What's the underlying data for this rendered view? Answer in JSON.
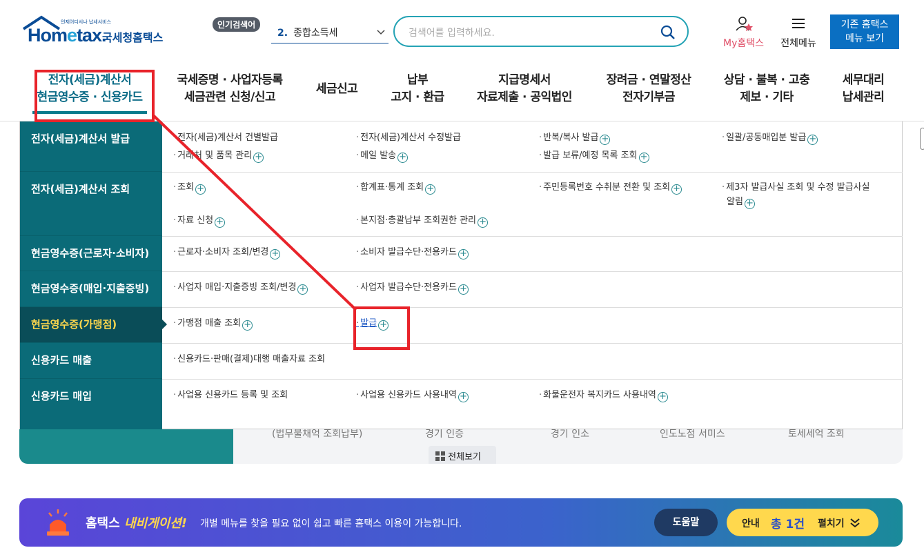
{
  "logo": {
    "sub": "언제어디서나 납세서비스",
    "word_a": "Hom",
    "word_e": "e",
    "word_b": "tax.",
    "kr": "국세청홈택스"
  },
  "popular": {
    "badge": "인기검색어",
    "rank": "2.",
    "term": "종합소득세"
  },
  "search": {
    "placeholder": "검색어를 입력하세요."
  },
  "top_links": {
    "myhome": "My홈택스",
    "allmenu": "전체메뉴",
    "legacy_line1": "기존 홈택스",
    "legacy_line2": "메뉴 보기"
  },
  "gnb": [
    {
      "l1": "전자(세금)계산서",
      "l2": "현금영수증 · 신용카드"
    },
    {
      "l1": "국세증명 · 사업자등록",
      "l2": "세금관련 신청/신고"
    },
    {
      "l1": "세금신고",
      "l2": ""
    },
    {
      "l1": "납부",
      "l2": "고지 · 환급"
    },
    {
      "l1": "지급명세서",
      "l2": "자료제출 · 공익법인"
    },
    {
      "l1": "장려금 · 연말정산",
      "l2": "전자기부금"
    },
    {
      "l1": "상담 · 불복 · 고충",
      "l2": "제보 · 기타"
    },
    {
      "l1": "세무대리",
      "l2": "납세관리"
    }
  ],
  "categories": [
    "전자(세금)계산서 발급",
    "전자(세금)계산서 조회",
    "현금영수증(근로자·소비자)",
    "현금영수증(매입·지출증빙)",
    "현금영수증(가맹점)",
    "신용카드 매출",
    "신용카드 매입"
  ],
  "links": {
    "r1": [
      "전자(세금)계산서 건별발급",
      "전자(세금)계산서 수정발급",
      "반복/복사 발급",
      "일괄/공동매입분 발급",
      "거래처 및 품목 관리",
      "메일 발송",
      "발급 보류/예정 목록 조회"
    ],
    "r2": [
      "조회",
      "합계표·통계 조회",
      "주민등록번호 수취분 전환 및 조회",
      "제3자 발급사실 조회 및 수정 발급사실",
      "알림",
      "자료 신청",
      "본지점·총괄납부 조회권한 관리"
    ],
    "r3": [
      "근로자·소비자 조회/변경",
      "소비자 발급수단·전용카드"
    ],
    "r4": [
      "사업자 매입·지출증빙 조회/변경",
      "사업자 발급수단·전용카드"
    ],
    "r5": [
      "가맹점 매출 조회",
      "발급"
    ],
    "r6": [
      "신용카드·판매(결제)대행 매출자료 조회"
    ],
    "r7": [
      "사업용 신용카드 등록 및 조회",
      "사업용 신용카드 사용내역",
      "화물운전자 복지카드 사용내역"
    ]
  },
  "background": {
    "tabs": [
      "(법무불채억 조회납부)",
      "경기 인증",
      "경기 인소",
      "인도노점 서미스",
      "토세세억 조회"
    ],
    "viewall": "전체보기"
  },
  "navbar": {
    "title_a": "홈택스",
    "title_b": "내비게이션!",
    "desc": "개별 메뉴를 찾을 필요 없이 쉽고 빠른 홈택스 이용이 가능합니다.",
    "help": "도움말",
    "notice_a": "안내",
    "notice_b": "총 1건",
    "notice_c": "펼치기"
  },
  "colors": {
    "brand": "#0a4c96",
    "teal": "#0b6b78",
    "annotation": "#e8232a",
    "highlight": "#ffd84d"
  }
}
